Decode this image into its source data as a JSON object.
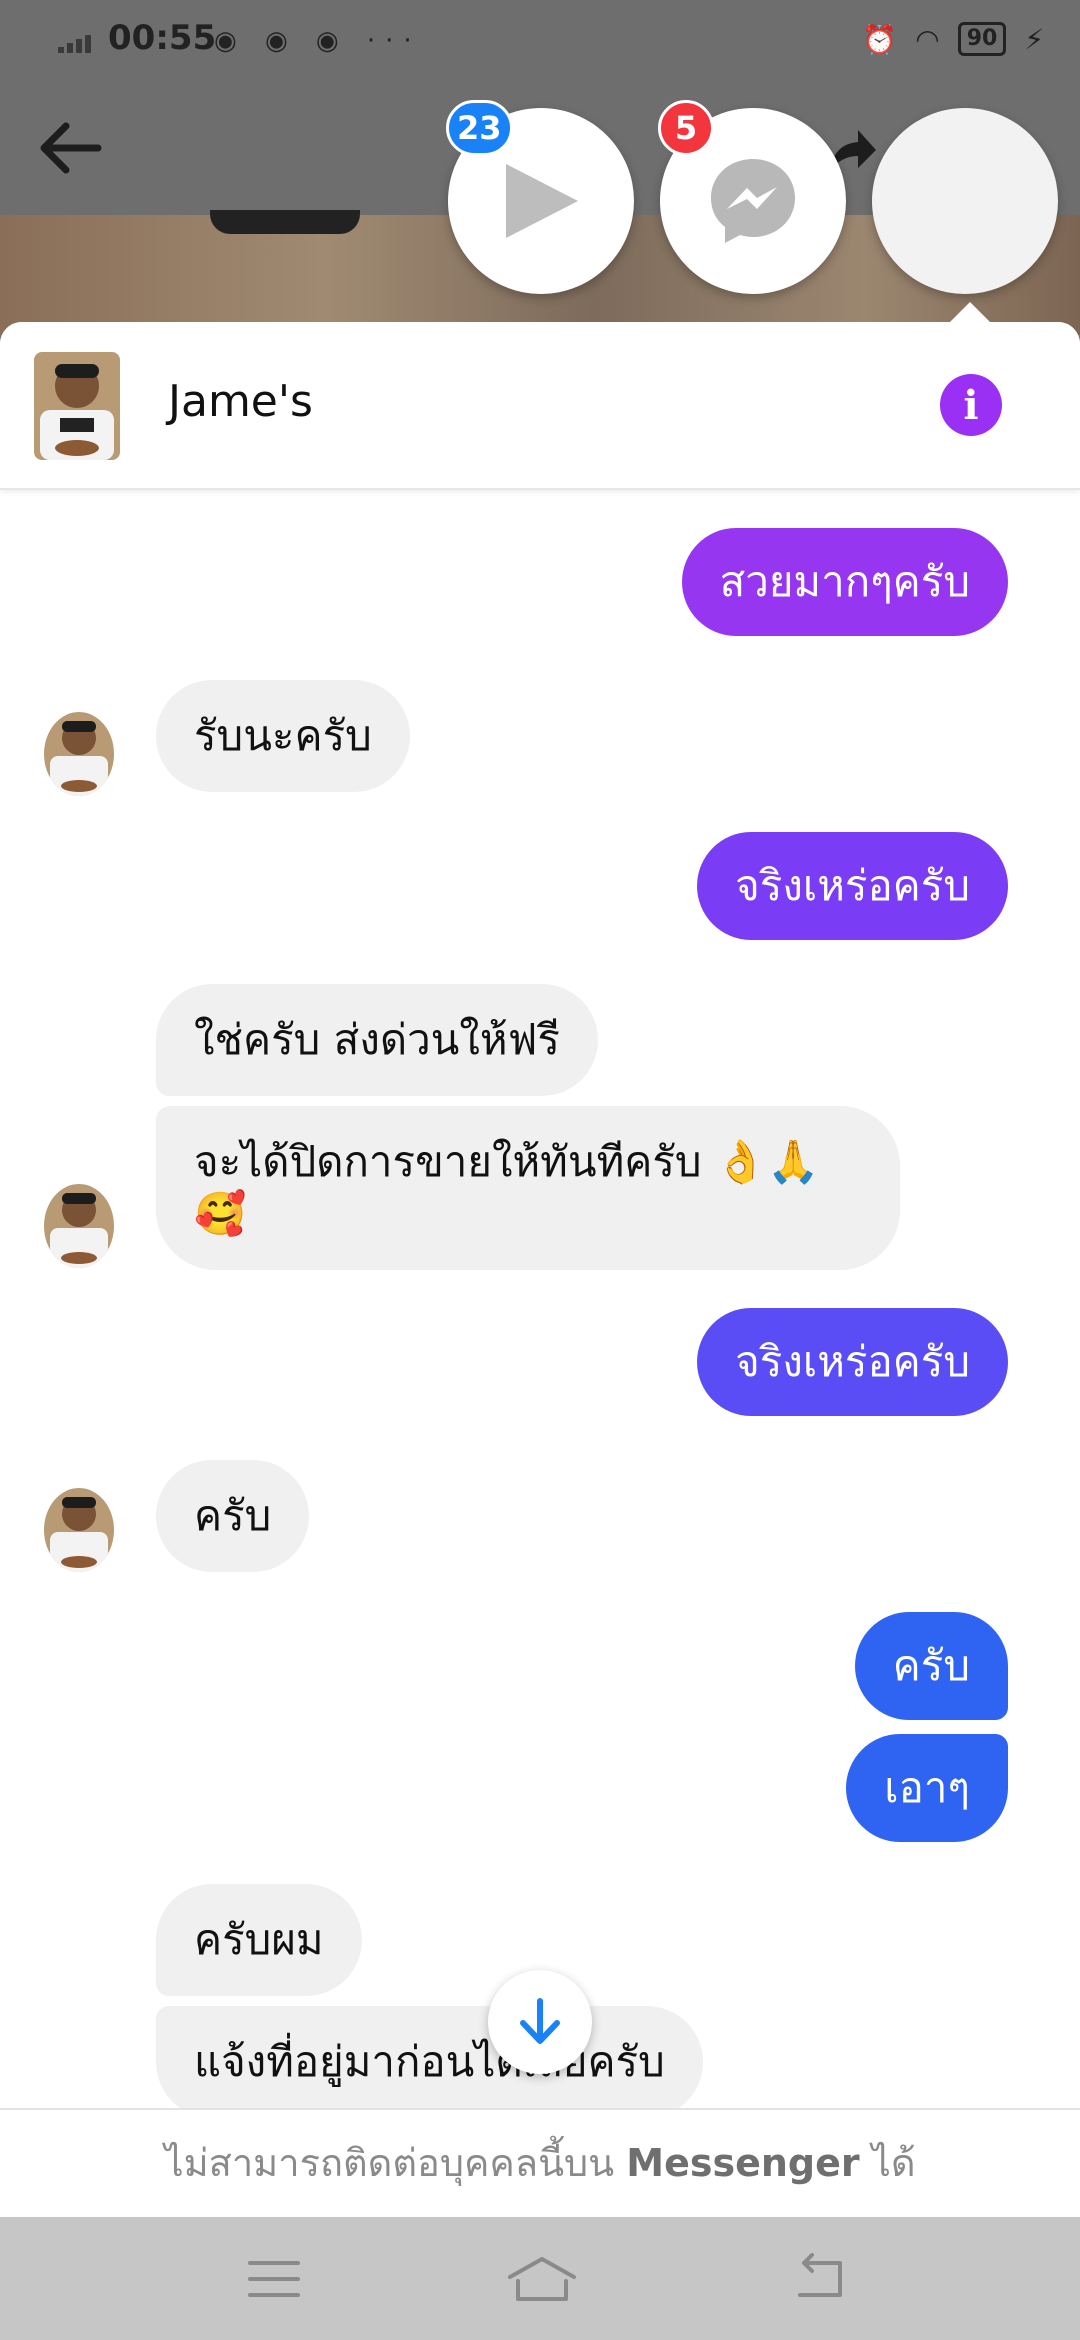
{
  "status_bar": {
    "time": "00:55",
    "app_icons": "◉ ◉ ◉ ···",
    "battery": "90"
  },
  "chat_heads": [
    {
      "name": "video-chathead",
      "badge": "23",
      "badge_color": "#1a82f7"
    },
    {
      "name": "messenger-chathead",
      "badge": "5",
      "badge_color": "#f3363e"
    },
    {
      "name": "active-chathead",
      "badge": null
    }
  ],
  "conversation": {
    "contact_name": "Jame's",
    "accent": "#9b30f5",
    "messages": [
      {
        "side": "out",
        "text": "สวยมากๆครับ",
        "color": "#9736f0"
      },
      {
        "side": "in",
        "text": "รับนะครับ"
      },
      {
        "side": "out",
        "text": "จริงเหร่อครับ",
        "color": "#7a3cf5"
      },
      {
        "side": "in",
        "text": "ใช่ครับ ส่งด่วนให้ฟรี"
      },
      {
        "side": "in",
        "text": "จะได้ปิดการขายให้ทันทีครับ 👌🙏🥰"
      },
      {
        "side": "out",
        "text": "จริงเหร่อครับ",
        "color": "#5b4df5"
      },
      {
        "side": "in",
        "text": "ครับ"
      },
      {
        "side": "out",
        "text": "ครับ",
        "color": "#2f63f2"
      },
      {
        "side": "out",
        "text": "เอาๆ",
        "color": "#2f63f2"
      },
      {
        "side": "in",
        "text": "ครับผม"
      },
      {
        "side": "in",
        "text": "แจ้งที่อยู่มาก่อนได้เลยครับ"
      }
    ]
  },
  "footer": {
    "text_prefix": "ไม่สามารถติดต่อบุคคลนี้บน ",
    "text_brand": "Messenger",
    "text_suffix": " ได้"
  },
  "navbar": {
    "items": [
      "menu-icon",
      "home-icon",
      "back-icon"
    ]
  }
}
